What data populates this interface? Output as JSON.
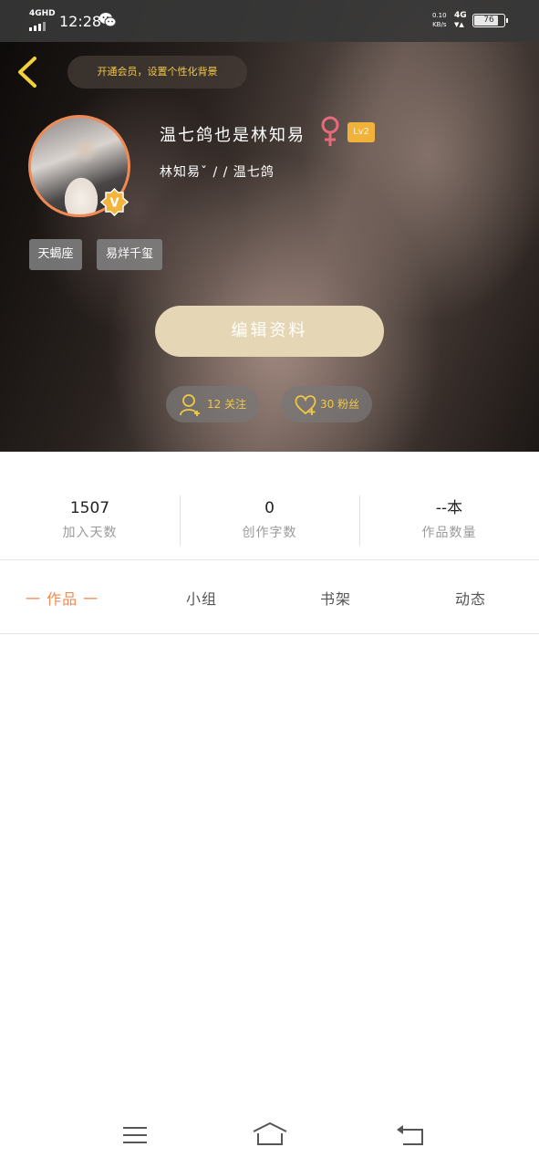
{
  "status_bar": {
    "network": "4GHD",
    "time": "12:28",
    "speed_value": "0.10",
    "speed_unit": "KB/s",
    "network_right": "4G",
    "battery": "76"
  },
  "header": {
    "vip_prompt": "开通会员，设置个性化背景",
    "nickname": "温七鸽也是林知易",
    "level": "Lv2",
    "signature": "林知易ˇ /  / 温七鸽",
    "tags": [
      "天蝎座",
      "易烊千玺"
    ],
    "edit_button": "编辑资料",
    "following": "12 关注",
    "followers": "30 粉丝"
  },
  "stats": [
    {
      "value": "1507",
      "label": "加入天数"
    },
    {
      "value": "0",
      "label": "创作字数"
    },
    {
      "value": "--本",
      "label": "作品数量"
    }
  ],
  "tabs": [
    {
      "label": "一 作品 一",
      "active": true
    },
    {
      "label": "小组",
      "active": false
    },
    {
      "label": "书架",
      "active": false
    },
    {
      "label": "动态",
      "active": false
    }
  ],
  "colors": {
    "accent": "#f08a55",
    "gold": "#f0c846",
    "edit_button": "#e5d7b5",
    "level_badge": "#f0b23a",
    "female_icon": "#e86a7a"
  },
  "icons": [
    "back-arrow-icon",
    "female-icon",
    "vip-v-icon",
    "add-user-icon",
    "heart-plus-icon",
    "menu-icon",
    "home-icon",
    "back-icon",
    "wechat-icon"
  ]
}
